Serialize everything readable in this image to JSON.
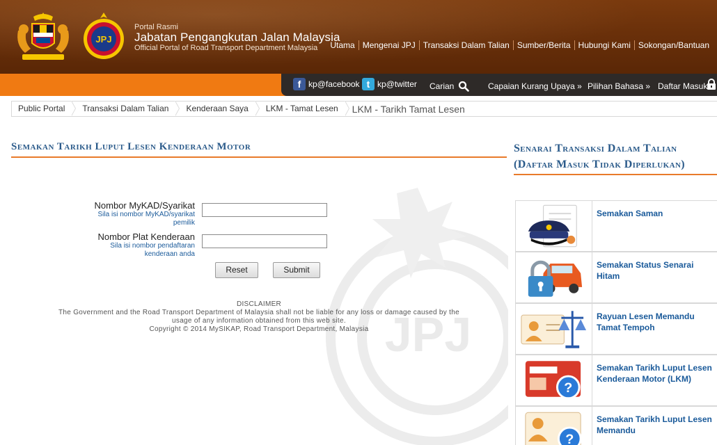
{
  "header": {
    "portal_rasmi": "Portal Rasmi",
    "dept_name": "Jabatan Pengangkutan Jalan Malaysia",
    "dept_en": "Official Portal of Road Transport Department Malaysia",
    "nav": [
      "Utama",
      "Mengenai JPJ",
      "Transaksi Dalam Talian",
      "Sumber/Berita",
      "Hubungi Kami",
      "Sokongan/Bantuan"
    ]
  },
  "utility": {
    "facebook": "kp@facebook",
    "twitter": "kp@twitter",
    "search": "Carian",
    "accessibility": "Capaian Kurang Upaya »",
    "language": "Pilihan Bahasa »",
    "login": "Daftar Masuk"
  },
  "breadcrumb": {
    "items": [
      "Public Portal",
      "Transaksi Dalam Talian",
      "Kenderaan Saya",
      "LKM - Tamat Lesen"
    ],
    "current": "LKM - Tarikh Tamat Lesen"
  },
  "form": {
    "title": "Semakan Tarikh Luput Lesen Kenderaan Motor",
    "mykad_label": "Nombor MyKAD/Syarikat",
    "mykad_hint_1": "Sila isi nombor MyKAD/syarikat",
    "mykad_hint_2": "pemilik",
    "mykad_value": "",
    "plate_label": "Nombor Plat Kenderaan",
    "plate_hint_1": "Sila isi nombor pendaftaran",
    "plate_hint_2": "kenderaan anda",
    "plate_value": "",
    "reset_label": "Reset",
    "submit_label": "Submit"
  },
  "disclaimer": {
    "heading": "DISCLAIMER",
    "line1": "The Government and the Road Transport Department of Malaysia shall not be liable for any loss or damage caused by the",
    "line2": "usage of any information obtained from this web site.",
    "copyright": "Copyright © 2014 MySIKAP, Road Transport Department, Malaysia"
  },
  "sidebar": {
    "title_line1": "Senarai Transaksi Dalam Talian",
    "title_line2": "(Daftar Masuk Tidak Diperlukan)",
    "items": [
      {
        "label": "Semakan Saman",
        "icon": "police-cap-icon"
      },
      {
        "label": "Semakan Status Senarai Hitam",
        "icon": "locked-car-icon"
      },
      {
        "label": "Rayuan Lesen Memandu Tamat Tempoh",
        "icon": "license-scale-icon"
      },
      {
        "label": "Semakan Tarikh Luput Lesen Kenderaan Motor (LKM)",
        "icon": "vehicle-license-question-icon"
      },
      {
        "label": "Semakan Tarikh Luput Lesen Memandu",
        "icon": "driving-license-question-icon"
      }
    ]
  },
  "colors": {
    "header_brown": "#6a300a",
    "orange_bar": "#f07a12",
    "title_blue": "#2a5a8a",
    "link_blue": "#1a5a9a"
  }
}
